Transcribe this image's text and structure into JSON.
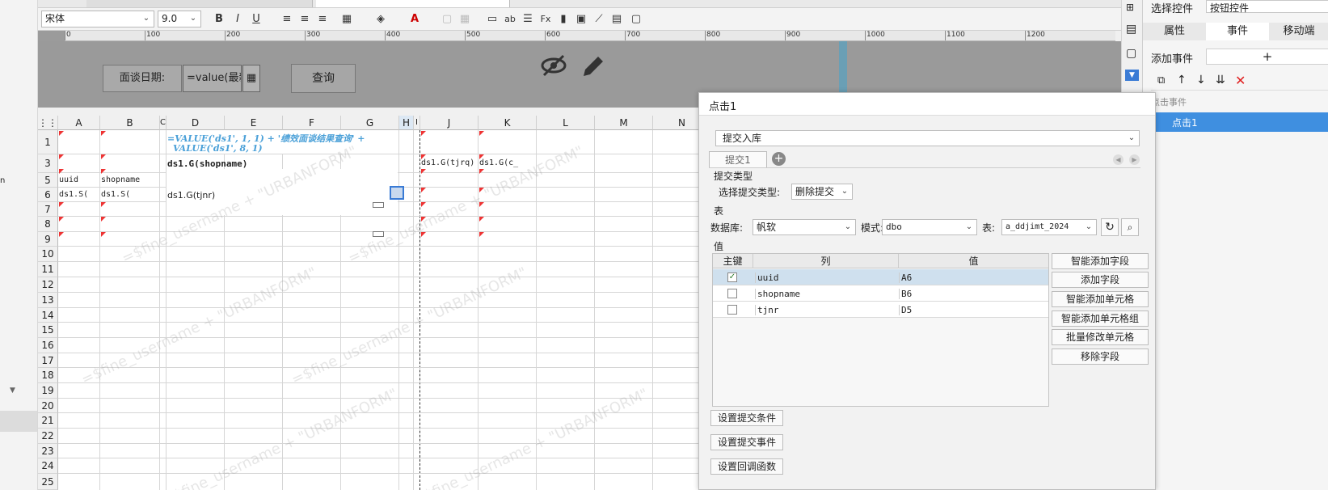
{
  "toolbar": {
    "font_name": "宋体",
    "font_size": "9.0"
  },
  "ruler": [
    "0",
    "100",
    "200",
    "300",
    "400",
    "500",
    "600",
    "700",
    "800",
    "900",
    "1000",
    "1100",
    "1200"
  ],
  "param_pane": {
    "date_label": "面谈日期:",
    "date_value": "=value(最新",
    "query_button": "查询"
  },
  "grid": {
    "columns": [
      "A",
      "B",
      "C",
      "D",
      "E",
      "F",
      "G",
      "H",
      "I",
      "J",
      "K",
      "L",
      "M",
      "N"
    ],
    "rows": [
      "1",
      "3",
      "5",
      "6",
      "7",
      "8",
      "9",
      "10",
      "11",
      "12",
      "13",
      "14",
      "15",
      "16",
      "17",
      "18",
      "19",
      "20",
      "21",
      "22",
      "23",
      "24",
      "25"
    ],
    "cells": {
      "d1_line1": "=VALUE('ds1', 1, 1) + '绩效面谈结果查询' +",
      "d1_line2": "VALUE('ds1', 8, 1)",
      "d3": "ds1.G(shopname)",
      "j3": "ds1.G(tjrq)",
      "k3": "ds1.G(c_",
      "a5": "uuid",
      "b5": "shopname",
      "a6": "ds1.S(",
      "b6": "ds1.S(",
      "d6": "ds1.G(tjnr)"
    },
    "watermark": "=$fine_username + \"URBANFORM\""
  },
  "right_panel": {
    "select_control_label": "选择控件",
    "select_control_value": "按钮控件",
    "tabs": [
      "属性",
      "事件",
      "移动端"
    ],
    "add_event_label": "添加事件",
    "event_group": "点击事件",
    "event_item": "点击1"
  },
  "dialog": {
    "title": "点击1",
    "action_select": "提交入库",
    "sub_tab": "提交1",
    "section_submit_type": "提交类型",
    "submit_type_label": "选择提交类型:",
    "submit_type_value": "删除提交",
    "section_table": "表",
    "db_label": "数据库:",
    "db_value": "帆软",
    "schema_label": "模式:",
    "schema_value": "dbo",
    "table_label": "表:",
    "table_value": "a_ddjimt_2024",
    "section_value": "值",
    "col_headers": [
      "主键",
      "列",
      "值"
    ],
    "rows": [
      {
        "key": true,
        "column": "uuid",
        "value": "A6"
      },
      {
        "key": false,
        "column": "shopname",
        "value": "B6"
      },
      {
        "key": false,
        "column": "tjnr",
        "value": "D5"
      }
    ],
    "side_buttons": [
      "智能添加字段",
      "添加字段",
      "智能添加单元格",
      "智能添加单元格组",
      "批量修改单元格",
      "移除字段"
    ],
    "bottom_buttons": [
      "设置提交条件",
      "设置提交事件",
      "设置回调函数"
    ]
  }
}
